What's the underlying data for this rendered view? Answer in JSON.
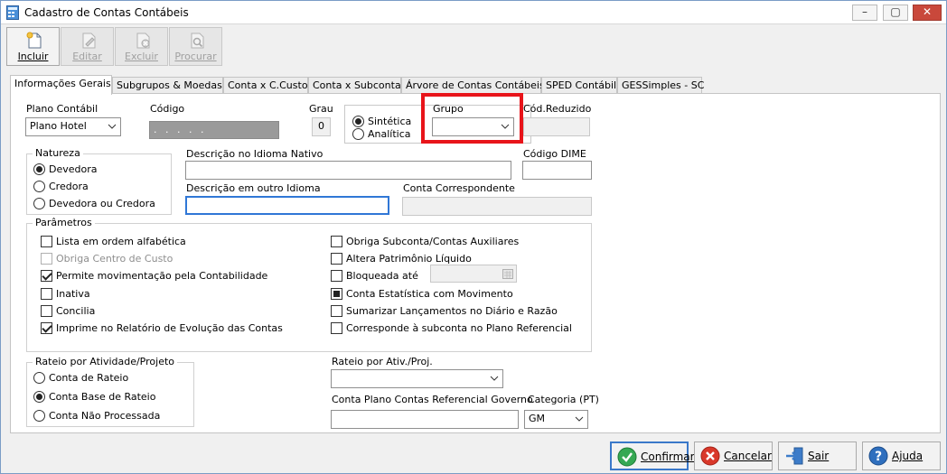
{
  "window": {
    "title": "Cadastro de Contas Contábeis",
    "controls": [
      "–",
      "▢",
      "✕"
    ]
  },
  "toolbar": {
    "incluir": "Incluir",
    "editar": "Editar",
    "excluir": "Excluir",
    "procurar": "Procurar"
  },
  "tabs": [
    "Informações Gerais",
    "Subgrupos & Moedas",
    "Conta x C.Custo",
    "Conta x Subconta",
    "Árvore de Contas Contábeis",
    "SPED Contábil",
    "GESSimples - SC"
  ],
  "form": {
    "plano_label": "Plano Contábil",
    "plano_value": "Plano Hotel",
    "codigo_label": "Código",
    "codigo_value": ". . . . .",
    "grau_label": "Grau",
    "grau_value": "0",
    "tipo": {
      "sintetica": "Sintética",
      "analitica": "Analítica",
      "selected": "Sintética"
    },
    "grupo_label": "Grupo",
    "grupo_value": "",
    "cod_reduzido_label": "Cód.Reduzido",
    "cod_reduzido_value": "",
    "natureza_title": "Natureza",
    "natureza": {
      "devedora": "Devedora",
      "credora": "Credora",
      "ambas": "Devedora ou Credora",
      "selected": "Devedora"
    },
    "descricao_nativo_label": "Descrição no Idioma Nativo",
    "descricao_nativo_value": "",
    "codigo_dime_label": "Código DIME",
    "codigo_dime_value": "",
    "descricao_outro_label": "Descrição em outro Idioma",
    "descricao_outro_value": "",
    "conta_correspondente_label": "Conta Correspondente",
    "conta_correspondente_value": "",
    "parametros_title": "Parâmetros",
    "parametros_left": [
      {
        "label": "Lista em ordem alfabética",
        "state": "unchecked"
      },
      {
        "label": "Obriga Centro de Custo",
        "state": "disabled"
      },
      {
        "label": "Permite movimentação pela Contabilidade",
        "state": "checked"
      },
      {
        "label": "Inativa",
        "state": "unchecked"
      },
      {
        "label": "Concilia",
        "state": "unchecked"
      },
      {
        "label": "Imprime no Relatório de Evolução das Contas",
        "state": "checked"
      }
    ],
    "parametros_right": [
      {
        "label": "Obriga Subconta/Contas Auxiliares",
        "state": "unchecked"
      },
      {
        "label": "Altera Patrimônio Líquido",
        "state": "unchecked"
      },
      {
        "label": "Bloqueada até",
        "state": "unchecked"
      },
      {
        "label": "Conta Estatística com Movimento",
        "state": "filled"
      },
      {
        "label": "Sumarizar Lançamentos no Diário e Razão",
        "state": "unchecked"
      },
      {
        "label": "Corresponde à subconta no Plano Referencial",
        "state": "unchecked"
      }
    ],
    "rateio_title": "Rateio por Atividade/Projeto",
    "rateio": {
      "conta_rateio": "Conta de Rateio",
      "conta_base": "Conta Base de Rateio",
      "nao_processada": "Conta Não Processada",
      "selected": "Conta Base de Rateio"
    },
    "rateio_ativ_label": "Rateio por Ativ./Proj.",
    "rateio_ativ_value": "",
    "conta_ref_label": "Conta Plano Contas Referencial Governo",
    "conta_ref_value": "",
    "categoria_label": "Categoria (PT)",
    "categoria_value": "GM"
  },
  "buttons": {
    "confirmar": "Confirmar",
    "cancelar": "Cancelar",
    "sair": "Sair",
    "ajuda": "Ajuda"
  },
  "colors": {
    "highlight": "#e8141a",
    "focus": "#3077d6"
  }
}
